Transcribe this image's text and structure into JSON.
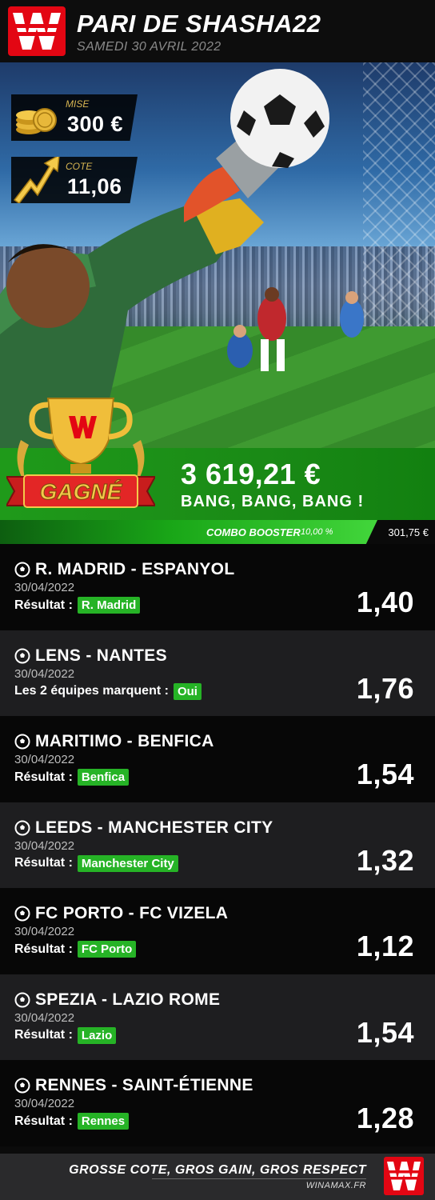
{
  "header": {
    "title": "PARI DE SHASHA22",
    "date": "SAMEDI 30 AVRIL 2022"
  },
  "stake": {
    "label": "MISE",
    "value": "300 €"
  },
  "odds": {
    "label": "COTE",
    "value": "11,06"
  },
  "result": {
    "badge": "GAGNÉ",
    "amount": "3 619,21 €",
    "tagline": "BANG, BANG, BANG !"
  },
  "combo_booster": {
    "label": "COMBO BOOSTER",
    "percent": "10,00 %",
    "amount": "301,75 €"
  },
  "bets": [
    {
      "match": "R. MADRID - ESPANYOL",
      "date": "30/04/2022",
      "market": "Résultat :",
      "pick": "R. Madrid",
      "odds": "1,40"
    },
    {
      "match": "LENS - NANTES",
      "date": "30/04/2022",
      "market": "Les 2 équipes marquent :",
      "pick": "Oui",
      "odds": "1,76"
    },
    {
      "match": "MARITIMO - BENFICA",
      "date": "30/04/2022",
      "market": "Résultat :",
      "pick": "Benfica",
      "odds": "1,54"
    },
    {
      "match": "LEEDS - MANCHESTER CITY",
      "date": "30/04/2022",
      "market": "Résultat :",
      "pick": "Manchester City",
      "odds": "1,32"
    },
    {
      "match": "FC PORTO - FC VIZELA",
      "date": "30/04/2022",
      "market": "Résultat :",
      "pick": "FC Porto",
      "odds": "1,12"
    },
    {
      "match": "SPEZIA - LAZIO ROME",
      "date": "30/04/2022",
      "market": "Résultat :",
      "pick": "Lazio",
      "odds": "1,54"
    },
    {
      "match": "RENNES - SAINT-ÉTIENNE",
      "date": "30/04/2022",
      "market": "Résultat :",
      "pick": "Rennes",
      "odds": "1,28"
    }
  ],
  "footer": {
    "slogan": "GROSSE COTE, GROS GAIN, GROS RESPECT",
    "url": "WINAMAX.FR"
  },
  "colors": {
    "brand_red": "#e30613",
    "win_green": "#1f9a1a",
    "pick_green": "#26b326",
    "gold": "#d8b652"
  },
  "icons": [
    "winamax-logo",
    "coins-icon",
    "rising-arrow-icon",
    "trophy-icon",
    "soccer-ball-icon"
  ]
}
